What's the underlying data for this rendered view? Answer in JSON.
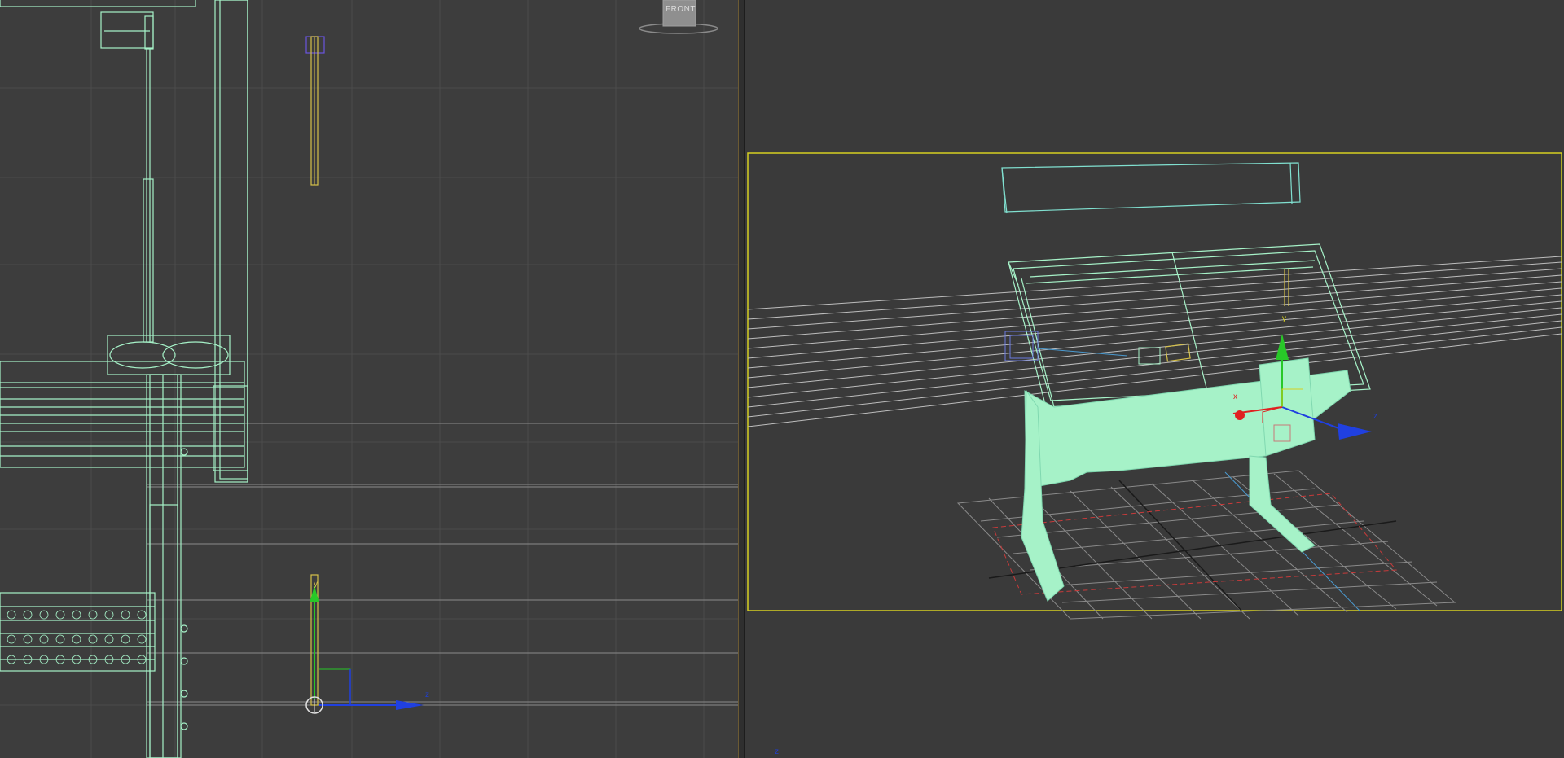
{
  "app": {
    "name": "3D modeling viewports"
  },
  "viewports": {
    "left": {
      "viewcube_label": "FRONT",
      "gizmo": {
        "horizontal_axis": "z",
        "vertical_axis": "y"
      }
    },
    "right": {
      "active": true,
      "gizmo": {
        "x_axis": "x",
        "y_axis": "y",
        "z_axis": "z"
      },
      "corner_axis_label": "z"
    }
  },
  "colors": {
    "background": "#3d3d3d",
    "grid": "#505050",
    "wireframe_selected": "#a6f2c8",
    "active_border": "#d6d021",
    "axis_x": "#e02020",
    "axis_y": "#28c828",
    "axis_z": "#2040e0"
  }
}
